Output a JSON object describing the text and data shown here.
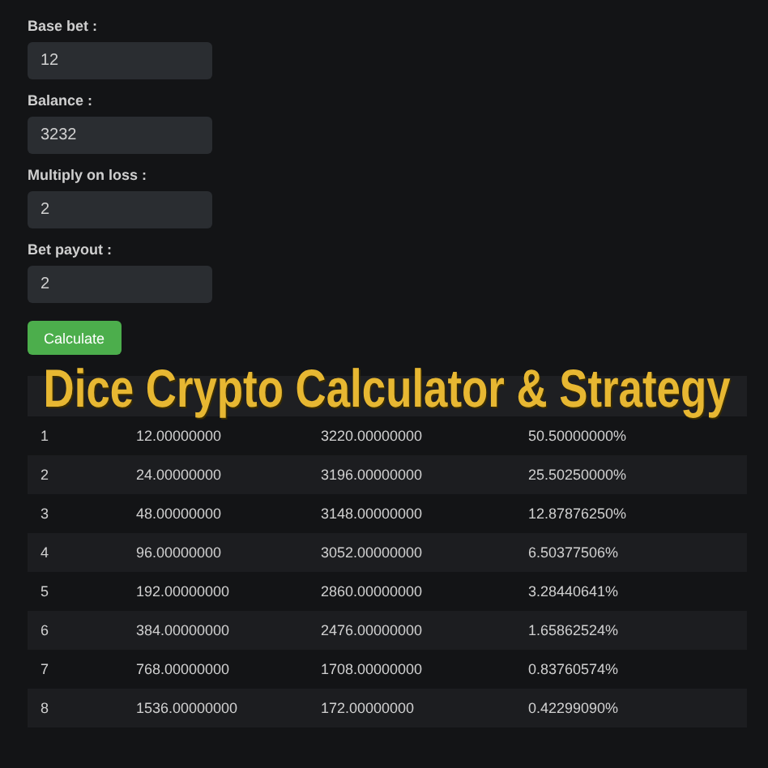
{
  "form": {
    "fields": [
      {
        "label": "Base bet :",
        "value": "12"
      },
      {
        "label": "Balance :",
        "value": "3232"
      },
      {
        "label": "Multiply on loss :",
        "value": "2"
      },
      {
        "label": "Bet payout :",
        "value": "2"
      }
    ],
    "button": "Calculate"
  },
  "banner": "Dice Crypto Calculator & Strategy",
  "table": {
    "rows": [
      [
        "1",
        "12.00000000",
        "3220.00000000",
        "50.50000000%"
      ],
      [
        "2",
        "24.00000000",
        "3196.00000000",
        "25.50250000%"
      ],
      [
        "3",
        "48.00000000",
        "3148.00000000",
        "12.87876250%"
      ],
      [
        "4",
        "96.00000000",
        "3052.00000000",
        "6.50377506%"
      ],
      [
        "5",
        "192.00000000",
        "2860.00000000",
        "3.28440641%"
      ],
      [
        "6",
        "384.00000000",
        "2476.00000000",
        "1.65862524%"
      ],
      [
        "7",
        "768.00000000",
        "1708.00000000",
        "0.83760574%"
      ],
      [
        "8",
        "1536.00000000",
        "172.00000000",
        "0.42299090%"
      ]
    ]
  }
}
